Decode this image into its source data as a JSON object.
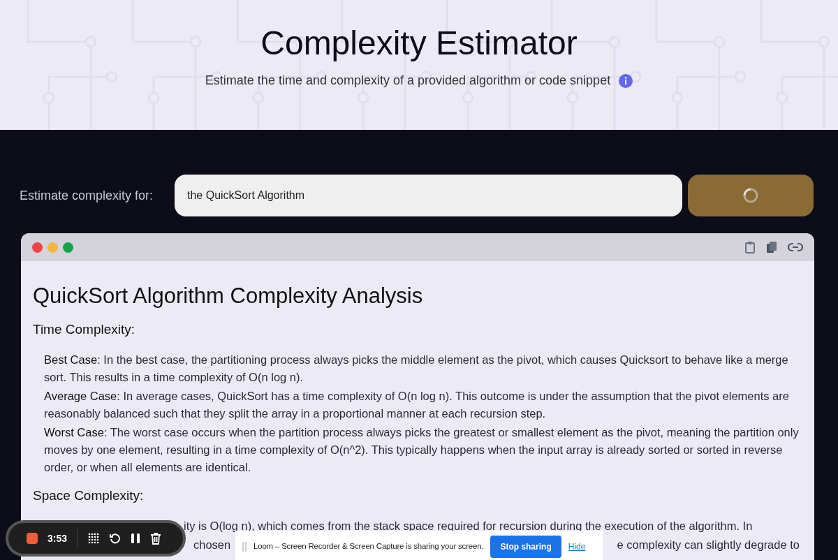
{
  "header": {
    "title": "Complexity Estimator",
    "subtitle": "Estimate the time and complexity of a provided algorithm or code snippet"
  },
  "query": {
    "label": "Estimate complexity for:",
    "value": "the QuickSort Algorithm",
    "button": {
      "loading": true
    }
  },
  "result": {
    "title": "QuickSort Algorithm Complexity Analysis",
    "sections": [
      {
        "heading": "Time Complexity:",
        "items": [
          {
            "term": "Best Case",
            "text": ": In the best case, the partitioning process always picks the middle element as the pivot, which causes Quicksort to behave like a merge sort. This results in a time complexity of O(n log n)."
          },
          {
            "term": "Average Case",
            "text": ": In average cases, QuickSort has a time complexity of O(n log n). This outcome is under the assumption that the pivot elements are reasonably balanced such that they split the array in a proportional manner at each recursion step."
          },
          {
            "term": "Worst Case",
            "text": ": The worst case occurs when the partition process always picks the greatest or smallest element as the pivot, meaning the partition only moves by one element, resulting in a time complexity of O(n^2). This typically happens when the input array is already sorted or sorted in reverse order, or when all elements are identical."
          }
        ]
      },
      {
        "heading": "Space Complexity:",
        "lines": [
          [
            "ity is O(log n), which comes from the stack space required for recursion during the execution of the algorithm. In"
          ],
          [
            "chosen",
            "e complexity can slightly degrade to"
          ]
        ]
      }
    ]
  },
  "recorder": {
    "time": "3:53"
  },
  "share_bar": {
    "message": "Loom – Screen Recorder & Screen Capture is sharing your screen.",
    "stop": "Stop sharing",
    "hide": "Hide"
  }
}
